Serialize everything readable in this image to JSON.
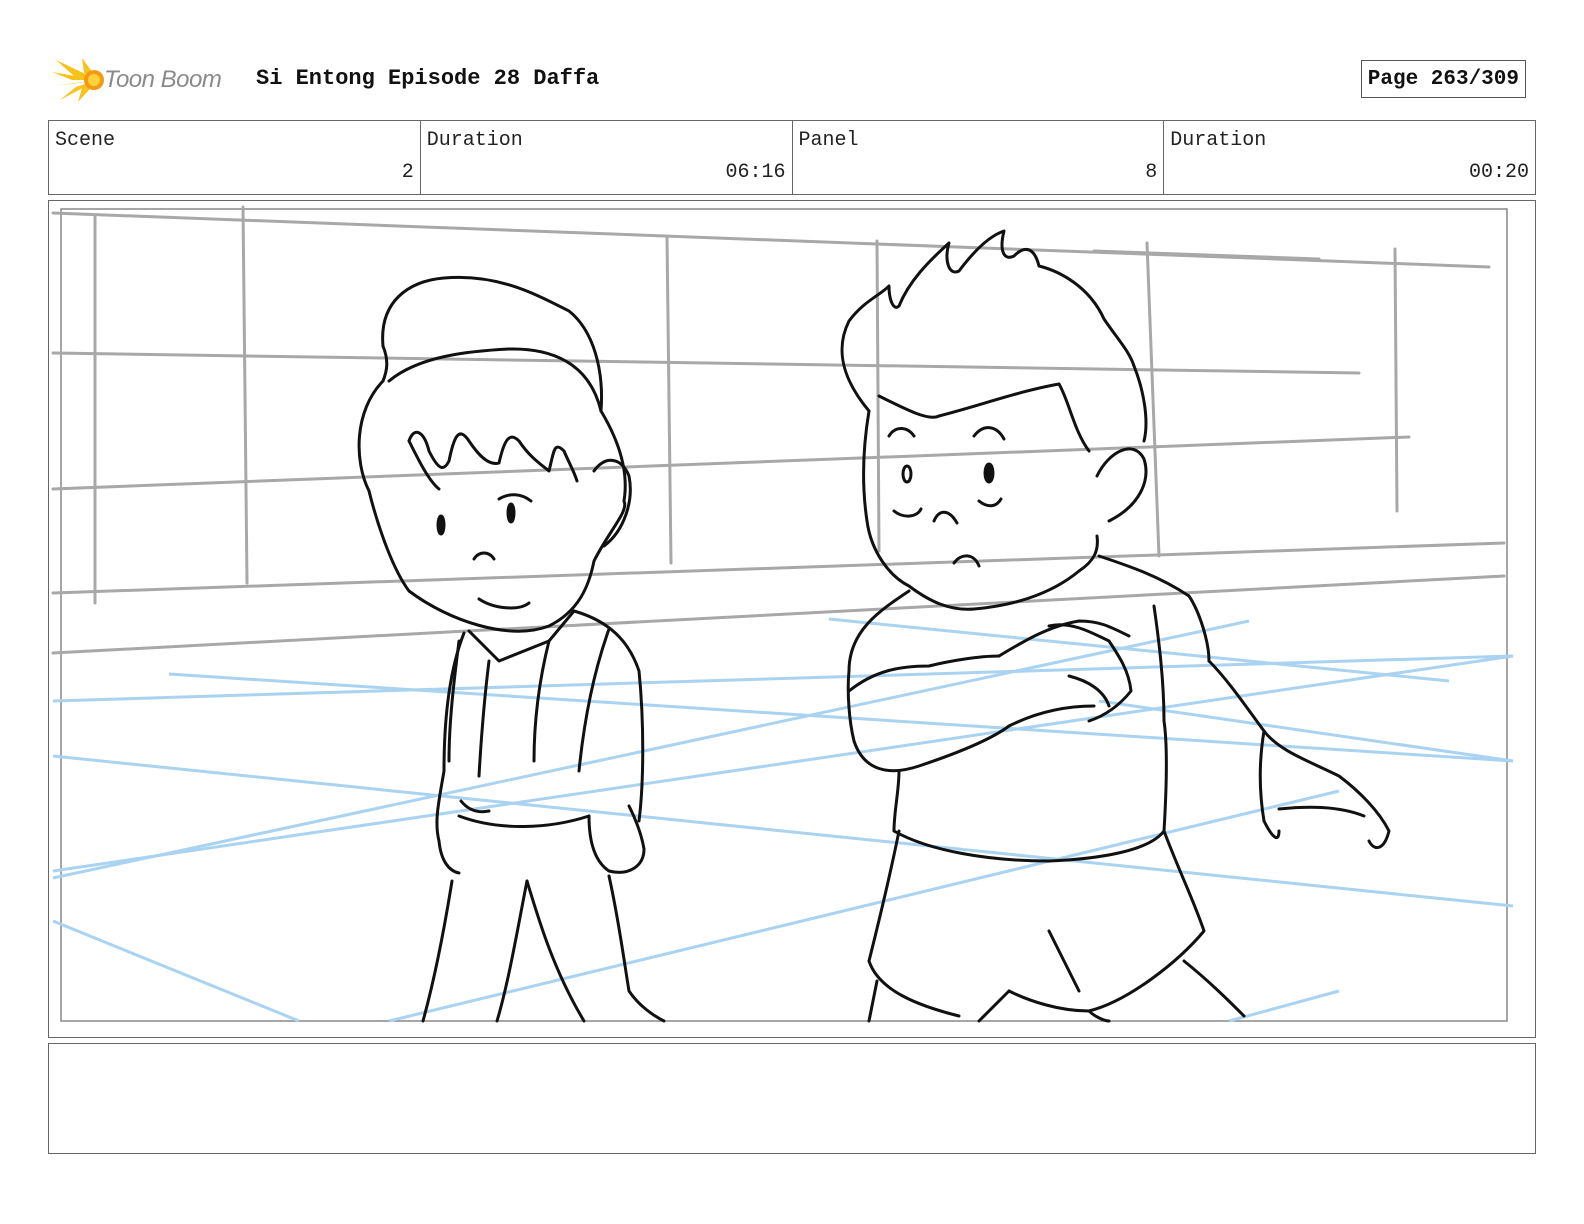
{
  "header": {
    "logo_text": "Toon Boom",
    "title": "Si Entong Episode 28 Daffa",
    "page": "Page 263/309"
  },
  "info": [
    {
      "label": "Scene",
      "value": "2"
    },
    {
      "label": "Duration",
      "value": "06:16"
    },
    {
      "label": "Panel",
      "value": "8"
    },
    {
      "label": "Duration",
      "value": "00:20"
    }
  ],
  "panel": {
    "description": "",
    "colors": {
      "grid": "#a8a8a8",
      "perspective": "#a9d3f0",
      "ink": "#111111"
    }
  },
  "notes": {
    "text": ""
  }
}
